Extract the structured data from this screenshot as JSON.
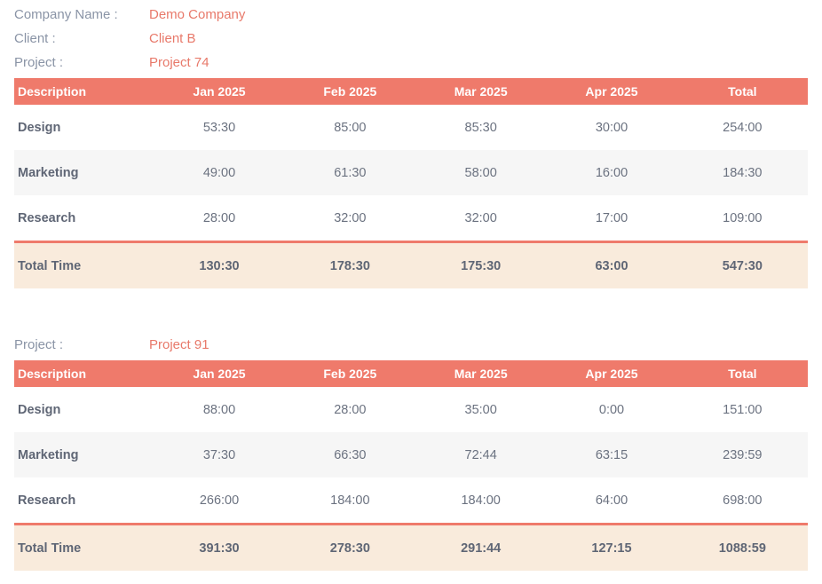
{
  "header": {
    "company_label": "Company Name :",
    "company_value": "Demo Company",
    "client_label": "Client :",
    "client_value": "Client B"
  },
  "columns": [
    "Description",
    "Jan 2025",
    "Feb 2025",
    "Mar 2025",
    "Apr 2025",
    "Total"
  ],
  "projects": [
    {
      "label": "Project :",
      "name": "Project 74",
      "rows": [
        [
          "Design",
          "53:30",
          "85:00",
          "85:30",
          "30:00",
          "254:00"
        ],
        [
          "Marketing",
          "49:00",
          "61:30",
          "58:00",
          "16:00",
          "184:30"
        ],
        [
          "Research",
          "28:00",
          "32:00",
          "32:00",
          "17:00",
          "109:00"
        ]
      ],
      "total": [
        "Total Time",
        "130:30",
        "178:30",
        "175:30",
        "63:00",
        "547:30"
      ]
    },
    {
      "label": "Project :",
      "name": "Project 91",
      "rows": [
        [
          "Design",
          "88:00",
          "28:00",
          "35:00",
          "0:00",
          "151:00"
        ],
        [
          "Marketing",
          "37:30",
          "66:30",
          "72:44",
          "63:15",
          "239:59"
        ],
        [
          "Research",
          "266:00",
          "184:00",
          "184:00",
          "64:00",
          "698:00"
        ]
      ],
      "total": [
        "Total Time",
        "391:30",
        "278:30",
        "291:44",
        "127:15",
        "1088:59"
      ]
    }
  ],
  "colors": {
    "accent": "#ef7a6b",
    "label": "#8a94a6",
    "total_bg": "#f9ebdc",
    "alt_row_bg": "#f6f6f6"
  }
}
